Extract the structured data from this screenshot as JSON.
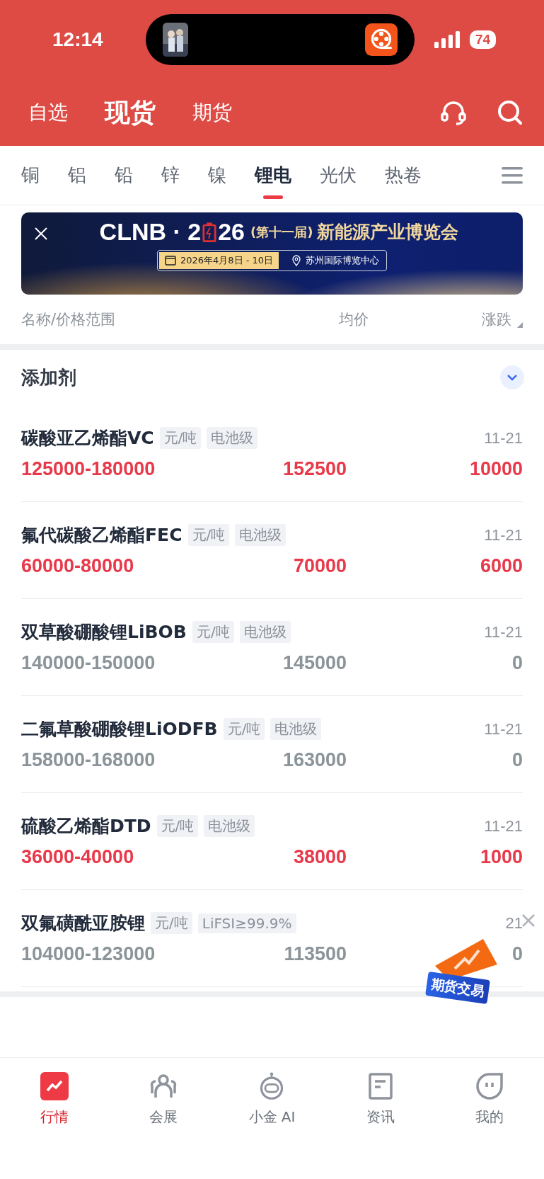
{
  "status_bar": {
    "time": "12:14",
    "battery": "74"
  },
  "header_tabs": [
    {
      "label": "自选",
      "selected": false
    },
    {
      "label": "现货",
      "selected": true
    },
    {
      "label": "期货",
      "selected": false
    }
  ],
  "category_tabs": [
    {
      "label": "铜",
      "selected": false
    },
    {
      "label": "铝",
      "selected": false
    },
    {
      "label": "铅",
      "selected": false
    },
    {
      "label": "锌",
      "selected": false
    },
    {
      "label": "镍",
      "selected": false
    },
    {
      "label": "锂电",
      "selected": true
    },
    {
      "label": "光伏",
      "selected": false
    },
    {
      "label": "热卷",
      "selected": false
    }
  ],
  "banner": {
    "brand_start": "CLNB · 2",
    "brand_end": "26",
    "edition": "(第十一届)",
    "title": "新能源产业博览会",
    "date": "2026年4月8日 - 10日",
    "venue": "苏州国际博览中心"
  },
  "columns": [
    "名称/价格范围",
    "均价",
    "涨跌"
  ],
  "section": {
    "title": "添加剂",
    "expanded": true
  },
  "rows": [
    {
      "name": "碳酸亚乙烯酯VC",
      "tags": [
        "元/吨",
        "电池级"
      ],
      "date": "11-21",
      "range": "125000-180000",
      "avg": "152500",
      "change": "10000",
      "kind": "up"
    },
    {
      "name": "氟代碳酸乙烯酯FEC",
      "tags": [
        "元/吨",
        "电池级"
      ],
      "date": "11-21",
      "range": "60000-80000",
      "avg": "70000",
      "change": "6000",
      "kind": "up"
    },
    {
      "name": "双草酸硼酸锂LiBOB",
      "tags": [
        "元/吨",
        "电池级"
      ],
      "date": "11-21",
      "range": "140000-150000",
      "avg": "145000",
      "change": "0",
      "kind": "flat"
    },
    {
      "name": "二氟草酸硼酸锂LiODFB",
      "tags": [
        "元/吨",
        "电池级"
      ],
      "date": "11-21",
      "range": "158000-168000",
      "avg": "163000",
      "change": "0",
      "kind": "flat"
    },
    {
      "name": "硫酸乙烯酯DTD",
      "tags": [
        "元/吨",
        "电池级"
      ],
      "date": "11-21",
      "range": "36000-40000",
      "avg": "38000",
      "change": "1000",
      "kind": "up"
    },
    {
      "name": "双氟磺酰亚胺锂",
      "tags": [
        "元/吨",
        "LiFSI≥99.9%"
      ],
      "date": "21",
      "range": "104000-123000",
      "avg": "113500",
      "change": "0",
      "kind": "flat"
    }
  ],
  "float_badge": {
    "label": "期货交易"
  },
  "bottom_nav": [
    {
      "label": "行情",
      "selected": true
    },
    {
      "label": "会展",
      "selected": false
    },
    {
      "label": "小金 AI",
      "selected": false
    },
    {
      "label": "资讯",
      "selected": false
    },
    {
      "label": "我的",
      "selected": false
    }
  ]
}
